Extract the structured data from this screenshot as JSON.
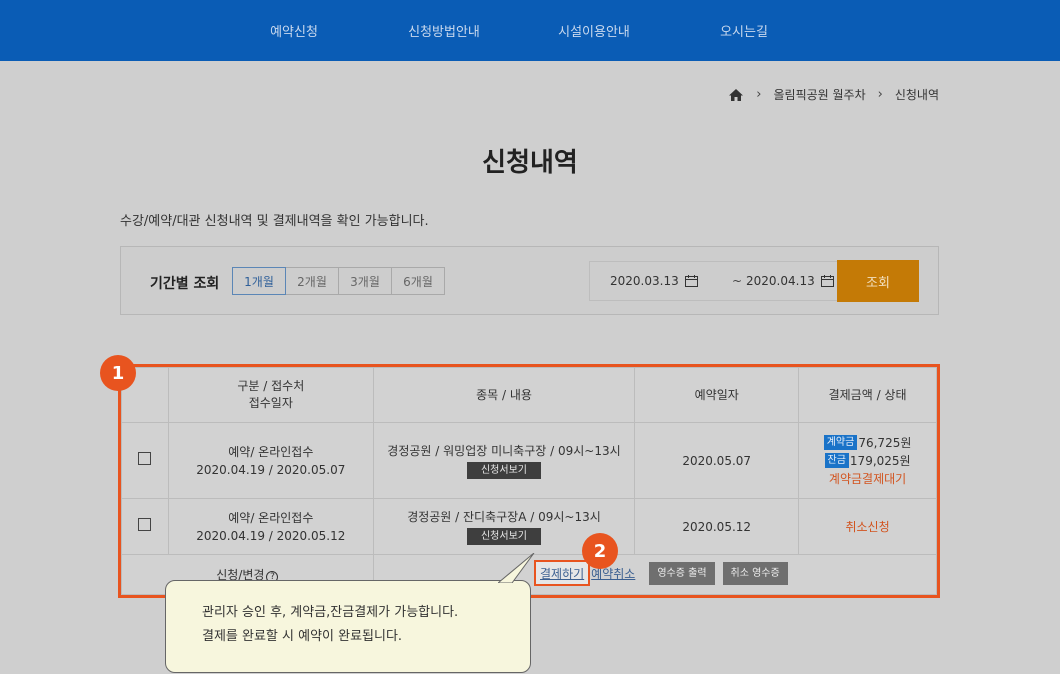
{
  "nav": [
    "예약신청",
    "신청방법안내",
    "시설이용안내",
    "오시는길"
  ],
  "breadcrumb": {
    "level1": "올림픽공원 월주차",
    "level2": "신청내역"
  },
  "page_title": "신청내역",
  "description": "수강/예약/대관 신청내역 및 결제내역을 확인 가능합니다.",
  "filter": {
    "label": "기간별 조회",
    "periods": [
      "1개월",
      "2개월",
      "3개월",
      "6개월"
    ],
    "active_period": "1개월",
    "date_from": "2020.03.13",
    "tilde": "~",
    "date_to": "2020.04.13",
    "search_label": "조회"
  },
  "table": {
    "headers": {
      "type": "구분 / 접수처",
      "type2": "접수일자",
      "item": "종목 / 내용",
      "date": "예약일자",
      "amount": "결제금액 / 상태"
    },
    "rows": [
      {
        "type": "예약/ 온라인접수",
        "period": "2020.04.19 / 2020.05.07",
        "item": "경정공원 / 워밍업장 미니축구장 / 09시~13시",
        "view_btn": "신청서보기",
        "date": "2020.05.07",
        "deposit_badge": "계약금",
        "deposit_amount": "76,725원",
        "balance_badge": "잔금",
        "balance_amount": "179,025원",
        "status": "계약금결제대기"
      },
      {
        "type": "예약/ 온라인접수",
        "period": "2020.04.19 / 2020.05.12",
        "item": "경정공원 / 잔디축구장A / 09시~13시",
        "view_btn": "신청서보기",
        "date": "2020.05.12",
        "status": "취소신청"
      }
    ],
    "footer": {
      "label": "신청/변경",
      "help": "?",
      "pay_label": "결제하기",
      "cancel_label": "예약취소",
      "receipt_label": "영수증 출력",
      "cancel_receipt_label": "취소 영수증"
    }
  },
  "markers": {
    "one": "1",
    "two": "2"
  },
  "callout": {
    "line1": "관리자 승인 후, 계약금,잔금결제가 가능합니다.",
    "line2": "결제를 완료할 시 예약이 완료됩니다."
  },
  "colors": {
    "nav_bg": "#0a5cb5",
    "accent": "#e8541f",
    "search_btn": "#c47a06",
    "badge": "#1a73c8"
  }
}
